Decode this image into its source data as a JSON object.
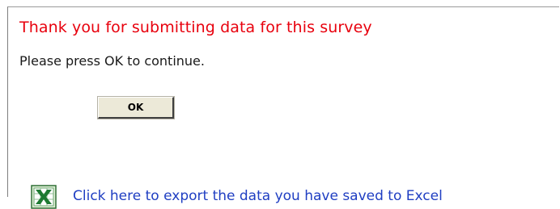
{
  "message": {
    "title": "Thank you for submitting data for this survey",
    "instruction": "Please press OK to continue."
  },
  "buttons": {
    "ok_label": "OK"
  },
  "export": {
    "icon": "excel-icon",
    "link_text": "Click here to export the data you have saved to Excel"
  },
  "colors": {
    "title": "#e8000d",
    "link": "#1f3ec2",
    "button_face": "#ece9d8",
    "excel_green": "#1e7a32"
  }
}
